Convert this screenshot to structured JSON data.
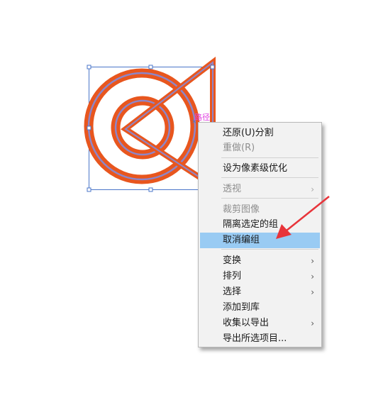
{
  "canvas": {
    "artwork_label": "路径",
    "artwork_stroke_color": "#e8561e",
    "artwork_inner_color": "#8e86c8",
    "selection_color": "#4a76c9"
  },
  "context_menu": {
    "items": [
      {
        "label": "还原(U)分割",
        "disabled": false,
        "submenu": false
      },
      {
        "label": "重做(R)",
        "disabled": true,
        "submenu": false
      },
      {
        "label": "设为像素级优化",
        "disabled": false,
        "submenu": false
      },
      {
        "label": "透视",
        "disabled": true,
        "submenu": true
      },
      {
        "label": "裁剪图像",
        "disabled": true,
        "submenu": false
      },
      {
        "label": "隔离选定的组",
        "disabled": false,
        "submenu": false
      },
      {
        "label": "取消编组",
        "disabled": false,
        "submenu": false,
        "highlighted": true
      },
      {
        "label": "变换",
        "disabled": false,
        "submenu": true
      },
      {
        "label": "排列",
        "disabled": false,
        "submenu": true
      },
      {
        "label": "选择",
        "disabled": false,
        "submenu": true
      },
      {
        "label": "添加到库",
        "disabled": false,
        "submenu": false
      },
      {
        "label": "收集以导出",
        "disabled": false,
        "submenu": true
      },
      {
        "label": "导出所选项目...",
        "disabled": false,
        "submenu": false
      }
    ],
    "submenu_glyph": "›",
    "highlight_color": "#99cbf3"
  },
  "annotation": {
    "arrow_color": "#e8343a"
  }
}
